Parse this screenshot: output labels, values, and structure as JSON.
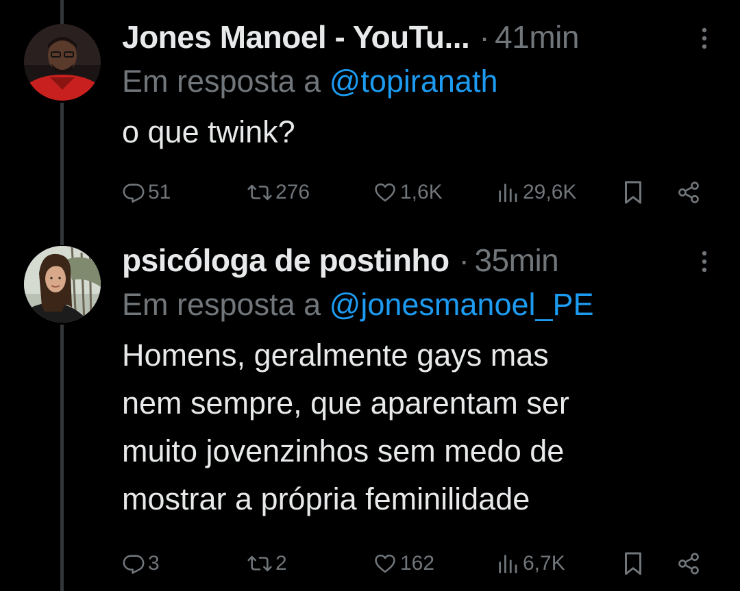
{
  "tweets": [
    {
      "display_name": "Jones Manoel - YouTu...",
      "separator": "·",
      "time": "41min",
      "reply_prefix": "Em resposta a",
      "reply_to": "@topiranath",
      "text": "o que twink?",
      "stats": {
        "replies": "51",
        "retweets": "276",
        "likes": "1,6K",
        "views": "29,6K"
      },
      "avatar_icon": "profile-photo-man-red-shirt"
    },
    {
      "display_name": "psicóloga de postinho",
      "separator": "·",
      "time": "35min",
      "reply_prefix": "Em resposta a",
      "reply_to": "@jonesmanoel_PE",
      "text_lines": [
        "Homens, geralmente gays mas",
        "nem sempre, que aparentam ser",
        "muito jovenzinhos sem medo de",
        "mostrar a própria feminilidade"
      ],
      "stats": {
        "replies": "3",
        "retweets": "2",
        "likes": "162",
        "views": "6,7K"
      },
      "avatar_icon": "profile-photo-woman-outdoors"
    }
  ],
  "icons": {
    "reply": "reply-icon",
    "retweet": "retweet-icon",
    "like": "heart-icon",
    "views": "views-icon",
    "bookmark": "bookmark-icon",
    "share": "share-icon",
    "more": "more-icon"
  },
  "colors": {
    "background": "#000000",
    "text": "#e7e9ea",
    "secondary": "#71767b",
    "link": "#1d9bf0",
    "thread_line": "#333639"
  }
}
